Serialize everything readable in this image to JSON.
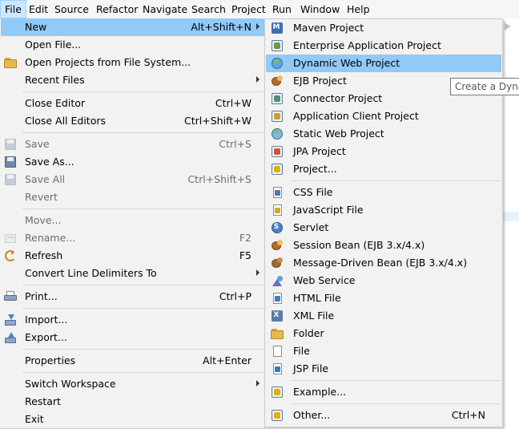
{
  "menubar": {
    "items": [
      {
        "label": "File",
        "active": true
      },
      {
        "label": "Edit"
      },
      {
        "label": "Source"
      },
      {
        "label": "Refactor"
      },
      {
        "label": "Navigate"
      },
      {
        "label": "Search"
      },
      {
        "label": "Project"
      },
      {
        "label": "Run"
      },
      {
        "label": "Window"
      },
      {
        "label": "Help"
      }
    ]
  },
  "file_menu": {
    "new": {
      "label": "New",
      "accel": "Alt+Shift+N",
      "submenu": true,
      "highlighted": true
    },
    "open_file": {
      "label": "Open File..."
    },
    "open_projects": {
      "label": "Open Projects from File System...",
      "icon": "folder-icon"
    },
    "recent_files": {
      "label": "Recent Files",
      "submenu": true
    },
    "close_editor": {
      "label": "Close Editor",
      "accel": "Ctrl+W"
    },
    "close_all_editors": {
      "label": "Close All Editors",
      "accel": "Ctrl+Shift+W"
    },
    "save": {
      "label": "Save",
      "accel": "Ctrl+S",
      "enabled": false,
      "icon": "save-icon"
    },
    "save_as": {
      "label": "Save As...",
      "icon": "save-as-icon"
    },
    "save_all": {
      "label": "Save All",
      "accel": "Ctrl+Shift+S",
      "enabled": false,
      "icon": "save-all-icon"
    },
    "revert": {
      "label": "Revert",
      "enabled": false
    },
    "move": {
      "label": "Move...",
      "enabled": false
    },
    "rename": {
      "label": "Rename...",
      "accel": "F2",
      "enabled": false,
      "icon": "rename-icon"
    },
    "refresh": {
      "label": "Refresh",
      "accel": "F5",
      "icon": "refresh-icon"
    },
    "convert_line_delimiters": {
      "label": "Convert Line Delimiters To",
      "submenu": true
    },
    "print": {
      "label": "Print...",
      "accel": "Ctrl+P",
      "icon": "printer-icon"
    },
    "import": {
      "label": "Import...",
      "icon": "import-icon"
    },
    "export": {
      "label": "Export...",
      "icon": "export-icon"
    },
    "properties": {
      "label": "Properties",
      "accel": "Alt+Enter"
    },
    "switch_workspace": {
      "label": "Switch Workspace",
      "submenu": true
    },
    "restart": {
      "label": "Restart"
    },
    "exit": {
      "label": "Exit"
    }
  },
  "new_menu": {
    "maven_project": {
      "label": "Maven Project",
      "icon": "maven-project-icon"
    },
    "enterprise_app": {
      "label": "Enterprise Application Project",
      "icon": "enterprise-application-icon"
    },
    "dynamic_web": {
      "label": "Dynamic Web Project",
      "icon": "dynamic-web-project-icon",
      "highlighted": true
    },
    "ejb_project": {
      "label": "EJB Project",
      "icon": "ejb-project-icon"
    },
    "connector_project": {
      "label": "Connector Project",
      "icon": "connector-project-icon"
    },
    "app_client": {
      "label": "Application Client Project",
      "icon": "application-client-icon"
    },
    "static_web": {
      "label": "Static Web Project",
      "icon": "static-web-project-icon"
    },
    "jpa_project": {
      "label": "JPA Project",
      "icon": "jpa-project-icon"
    },
    "project": {
      "label": "Project...",
      "icon": "new-project-icon"
    },
    "css_file": {
      "label": "CSS File",
      "icon": "css-file-icon"
    },
    "js_file": {
      "label": "JavaScript File",
      "icon": "javascript-file-icon"
    },
    "servlet": {
      "label": "Servlet",
      "icon": "servlet-icon"
    },
    "session_bean": {
      "label": "Session Bean (EJB 3.x/4.x)",
      "icon": "session-bean-icon"
    },
    "mdb": {
      "label": "Message-Driven Bean (EJB 3.x/4.x)",
      "icon": "message-driven-bean-icon"
    },
    "web_service": {
      "label": "Web Service",
      "icon": "web-service-icon"
    },
    "html_file": {
      "label": "HTML File",
      "icon": "html-file-icon"
    },
    "xml_file": {
      "label": "XML File",
      "icon": "xml-file-icon"
    },
    "folder": {
      "label": "Folder",
      "icon": "folder-icon"
    },
    "file": {
      "label": "File",
      "icon": "file-icon"
    },
    "jsp_file": {
      "label": "JSP File",
      "icon": "jsp-file-icon"
    },
    "example": {
      "label": "Example...",
      "icon": "example-icon"
    },
    "other": {
      "label": "Other...",
      "accel": "Ctrl+N",
      "icon": "other-wizard-icon"
    }
  },
  "tooltip": {
    "text": "Create a Dynamic Web Project"
  },
  "colors": {
    "menu_bg": "#f2f2f2",
    "highlight": "#91c9f7",
    "menubar_active": "#cce8ff",
    "disabled_text": "#6d6d6d"
  }
}
